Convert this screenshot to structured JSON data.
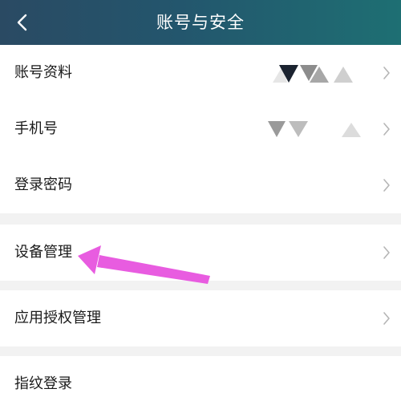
{
  "header": {
    "title": "账号与安全",
    "back_icon": "chevron-left-icon"
  },
  "groups": [
    {
      "items": [
        {
          "label": "账号资料",
          "has_value_icons": true
        },
        {
          "label": "手机号",
          "has_value_icons": true
        },
        {
          "label": "登录密码",
          "has_value_icons": false
        }
      ]
    },
    {
      "items": [
        {
          "label": "设备管理",
          "has_value_icons": false
        }
      ]
    },
    {
      "items": [
        {
          "label": "应用授权管理",
          "has_value_icons": false
        }
      ]
    },
    {
      "items": [
        {
          "label": "指纹登录",
          "has_value_icons": false
        }
      ]
    }
  ],
  "annotation": {
    "color": "#e85ce0",
    "target": "设备管理"
  },
  "colors": {
    "header_start": "#2a4a63",
    "header_end": "#1e6f73",
    "background": "#f2f2f2",
    "row": "#ffffff",
    "chevron": "#b5b5b5"
  }
}
